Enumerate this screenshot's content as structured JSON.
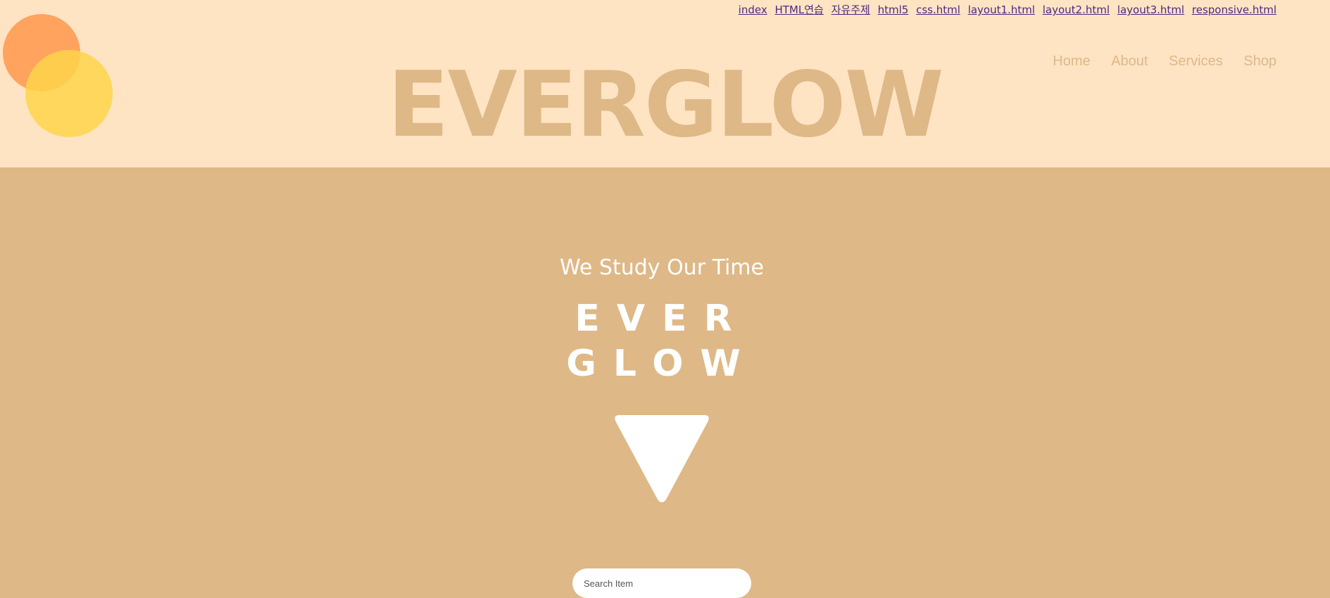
{
  "top_links": [
    "index",
    "HTML연습",
    "자유주제",
    "html5",
    "css.html",
    "layout1.html",
    "layout2.html",
    "layout3.html",
    "responsive.html"
  ],
  "nav": {
    "home": "Home",
    "about": "About",
    "services": "Services",
    "shop": "Shop"
  },
  "brand": "EVERGLOW",
  "hero": {
    "tagline": "We Study Our Time",
    "line1": "EVER",
    "line2": "GLOW"
  },
  "search": {
    "placeholder": "Search Item"
  },
  "colors": {
    "header_bg": "#ffe4c4",
    "hero_bg": "#deb887",
    "brand_text": "#deb887",
    "hero_text": "#ffffff",
    "circle_orange": "#ff9f5a",
    "circle_yellow": "#ffd54a",
    "link_color": "#4b2a80"
  },
  "icons": {
    "scroll_indicator": "triangle-down-icon"
  }
}
